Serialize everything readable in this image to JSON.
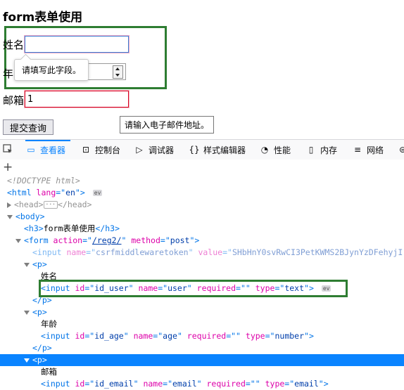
{
  "preview": {
    "heading": "form表单使用",
    "name_label": "姓名",
    "name_value": "",
    "age_label_partial": "年",
    "email_label": "邮箱",
    "email_value": "1",
    "submit_label": "提交查询",
    "tooltip_required": "请填写此字段。",
    "tooltip_email": "请输入电子邮件地址。"
  },
  "toolbar": {
    "tabs": [
      {
        "label": "查看器",
        "icon": "inspector-icon",
        "selected": true
      },
      {
        "label": "控制台",
        "icon": "console-icon"
      },
      {
        "label": "调试器",
        "icon": "debugger-icon"
      },
      {
        "label": "样式编辑器",
        "icon": "style-editor-icon"
      },
      {
        "label": "性能",
        "icon": "performance-icon"
      },
      {
        "label": "内存",
        "icon": "memory-icon"
      },
      {
        "label": "网络",
        "icon": "network-icon"
      }
    ],
    "colors": {
      "accent": "#0a84ff",
      "highlight": "#2e7d32",
      "invalid": "#d70022"
    }
  },
  "tree": {
    "doctype": "<!DOCTYPE html>",
    "html_lang": "en",
    "h3_text": "form表单使用",
    "form_action": "/reg2/",
    "form_method": "post",
    "csrf_name": "csrfmiddlewaretoken",
    "csrf_value": "SHbHnY0svRwCI3PetKWMS2BJynYzDFehyjI",
    "label_name": "姓名",
    "input_user": {
      "id": "id_user",
      "name": "user",
      "required": "",
      "type": "text"
    },
    "label_age": "年龄",
    "input_age": {
      "id": "id_age",
      "name": "age",
      "required": "",
      "type": "number"
    },
    "label_email": "邮箱",
    "input_email": {
      "id": "id_email",
      "name": "email",
      "required": "",
      "type": "email"
    },
    "ev_badge": "ev"
  }
}
